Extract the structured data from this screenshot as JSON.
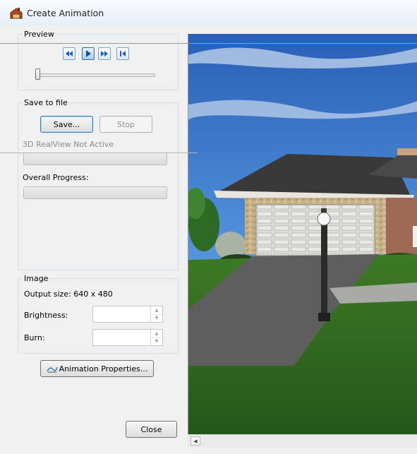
{
  "window": {
    "title": "Create Animation",
    "icon": "create-animation-icon"
  },
  "preview": {
    "legend": "Preview",
    "nav_buttons": [
      {
        "name": "rewind-icon"
      },
      {
        "name": "play-icon"
      },
      {
        "name": "fast-forward-icon"
      },
      {
        "name": "go-to-start-icon"
      }
    ],
    "slider_position": 0
  },
  "save_to_file": {
    "legend": "Save to file",
    "save_label": "Save...",
    "stop_label": "Stop",
    "realview_status": "3D RealView Not Active",
    "overall_progress_label": "Overall Progress:",
    "frame_progress": 0,
    "overall_progress": 0
  },
  "image": {
    "legend": "Image",
    "output_size": "Output size: 640 x 480",
    "brightness_label": "Brightness:",
    "brightness_value": "",
    "burn_label": "Burn:",
    "burn_value": ""
  },
  "buttons": {
    "animation_properties": "Animation Properties...",
    "close": "Close"
  },
  "colors": {
    "accent": "#3c7fb1",
    "sky": "#3c78c8",
    "lawn": "#2e6a1c"
  }
}
